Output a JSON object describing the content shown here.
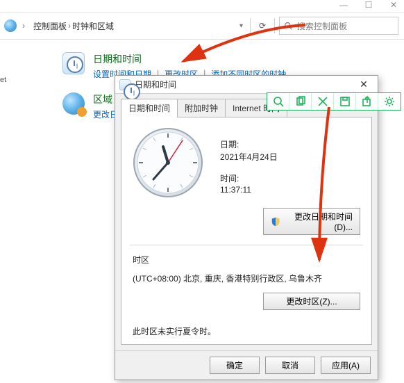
{
  "window": {
    "breadcrumb": {
      "root": "控制面板",
      "current": "时钟和区域"
    },
    "refresh_tooltip": "刷新",
    "search_placeholder": "搜索控制面板"
  },
  "sidebar_fragment": "et",
  "categories": {
    "datetime": {
      "title": "日期和时间",
      "links": [
        "设置时间和日期",
        "更改时区",
        "添加不同时区的时钟"
      ]
    },
    "region": {
      "title": "区域",
      "link_partial": "更改日"
    }
  },
  "dialog": {
    "title": "日期和时间",
    "tabs": [
      "日期和时间",
      "附加时钟",
      "Internet 时间"
    ],
    "date_label": "日期:",
    "date_value": "2021年4月24日",
    "time_label": "时间:",
    "time_value": "11:37:11",
    "btn_change_dt": "更改日期和时间(D)...",
    "tz_head": "时区",
    "tz_value": "(UTC+08:00) 北京, 重庆, 香港特别行政区, 乌鲁木齐",
    "btn_change_tz": "更改时区(Z)...",
    "dst_note": "此时区未实行夏令时。",
    "btn_ok": "确定",
    "btn_cancel": "取消",
    "btn_apply": "应用(A)"
  },
  "toolbar_icons": [
    "search",
    "copy",
    "shuffle",
    "save",
    "share",
    "settings"
  ]
}
